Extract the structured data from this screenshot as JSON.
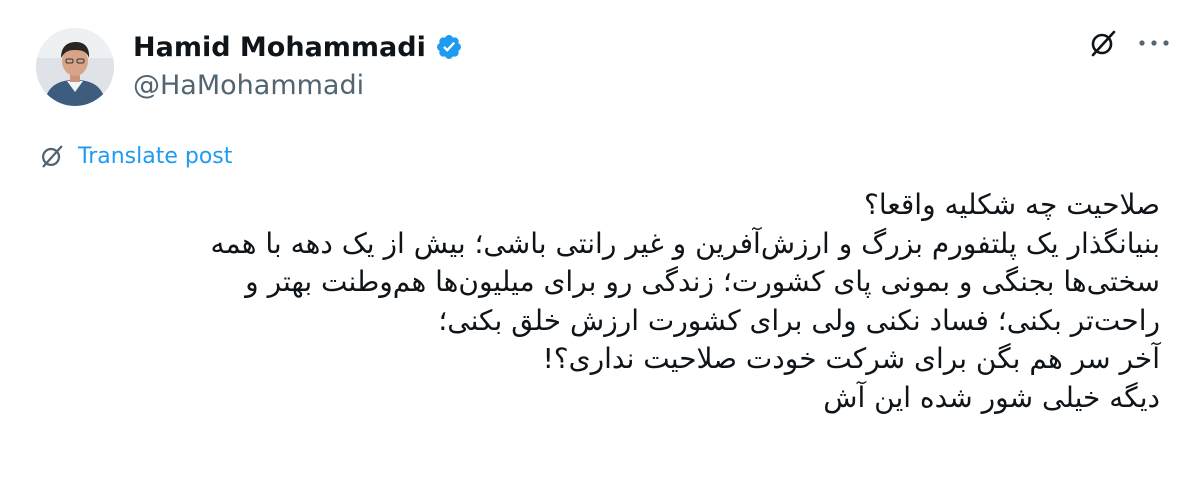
{
  "author": {
    "display_name": "Hamid Mohammadi",
    "handle": "@HaMohammadi",
    "verified": true
  },
  "icons": {
    "verified": "verified-badge-icon",
    "grok": "grok-icon",
    "more": "more-options-icon",
    "translate": "grok-translate-icon"
  },
  "colors": {
    "accent": "#1d9bf0",
    "secondary_text": "#536471",
    "primary_text": "#0f1419"
  },
  "translate": {
    "label": "Translate post"
  },
  "post": {
    "lines": [
      "صلاحیت چه شکلیه واقعا؟",
      "بنیانگذار یک پلتفورم بزرگ و ارزش‌آفرین و غیر رانتی باشی؛ بیش از یک دهه با همه",
      "سختی‌ها بجنگی و بمونی پای کشورت؛ زندگی رو برای میلیون‌ها هم‌وطنت بهتر و",
      "راحت‌تر بکنی؛ فساد نکنی ولی برای کشورت ارزش خلق بکنی؛",
      "آخر سر هم بگن برای شرکت خودت صلاحیت نداری؟!",
      "دیگه خیلی شور شده این آش"
    ]
  }
}
